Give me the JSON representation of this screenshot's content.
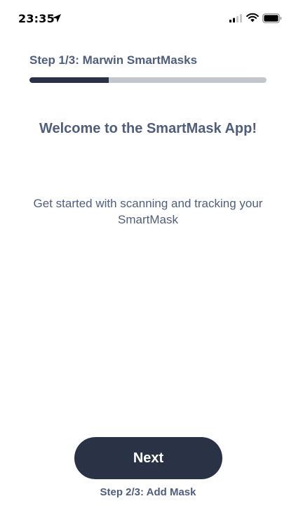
{
  "status_bar": {
    "time": "23:35",
    "icons": [
      "location-arrow-icon",
      "cellular-signal-icon",
      "wifi-icon",
      "battery-icon"
    ]
  },
  "onboarding": {
    "step_title": "Step 1/3: Marwin SmartMasks",
    "progress_fraction": 0.333,
    "heading": "Welcome to the SmartMask App!",
    "description": "Get started with scanning and tracking your SmartMask",
    "next_button_label": "Next",
    "next_step_label": "Step 2/3: Add Mask"
  },
  "colors": {
    "text": "#4f5e7d",
    "primary": "#2a3246",
    "progress_track": "#c3c6cc",
    "background": "#ffffff"
  }
}
